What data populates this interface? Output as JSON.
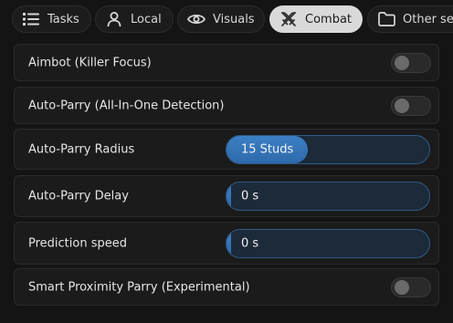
{
  "tabs": [
    {
      "label": "Tasks",
      "icon": "list-icon",
      "active": false
    },
    {
      "label": "Local",
      "icon": "user-icon",
      "active": false
    },
    {
      "label": "Visuals",
      "icon": "eye-icon",
      "active": false
    },
    {
      "label": "Combat",
      "icon": "crossed-swords-icon",
      "active": true
    },
    {
      "label": "Other se",
      "icon": "folder-icon",
      "active": false
    }
  ],
  "settings": {
    "aimbot": {
      "label": "Aimbot (Killer Focus)",
      "enabled": false
    },
    "auto_parry": {
      "label": "Auto-Parry (All-In-One Detection)",
      "enabled": false
    },
    "radius": {
      "label": "Auto-Parry Radius",
      "value_text": "15 Studs",
      "fill_fraction": 0.4
    },
    "delay": {
      "label": "Auto-Parry Delay",
      "value_text": "0 s",
      "fill_fraction": 0.0
    },
    "prediction": {
      "label": "Prediction speed",
      "value_text": "0 s",
      "fill_fraction": 0.0
    },
    "smart_proximity": {
      "label": "Smart Proximity Parry (Experimental)",
      "enabled": false
    }
  },
  "colors": {
    "accent": "#3c7fc4",
    "slider_bg": "#1c2a3a",
    "active_tab_bg": "#d9d9d9"
  }
}
